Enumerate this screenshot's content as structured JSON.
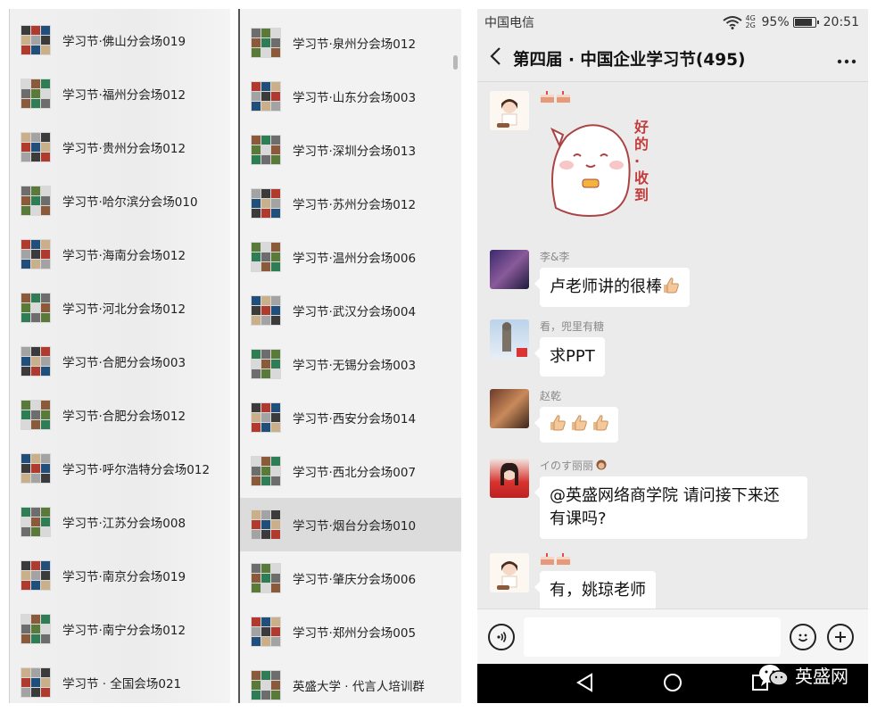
{
  "left_list": {
    "items": [
      {
        "label": "学习节·佛山分会场019"
      },
      {
        "label": "学习节·福州分会场012"
      },
      {
        "label": "学习节·贵州分会场012"
      },
      {
        "label": "学习节·哈尔滨分会场010"
      },
      {
        "label": "学习节·海南分会场012"
      },
      {
        "label": "学习节·河北分会场012"
      },
      {
        "label": "学习节·合肥分会场003"
      },
      {
        "label": "学习节·合肥分会场012"
      },
      {
        "label": "学习节·呼尔浩特分会场012"
      },
      {
        "label": "学习节·江苏分会场008"
      },
      {
        "label": "学习节·南京分会场019"
      },
      {
        "label": "学习节·南宁分会场012"
      },
      {
        "label": "学习节 · 全国会场021"
      }
    ]
  },
  "mid_list": {
    "items": [
      {
        "label": "学习节·泉州分会场012"
      },
      {
        "label": "学习节·山东分会场003"
      },
      {
        "label": "学习节·深圳分会场013"
      },
      {
        "label": "学习节·苏州分会场012"
      },
      {
        "label": "学习节·温州分会场006"
      },
      {
        "label": "学习节·武汉分会场004"
      },
      {
        "label": "学习节·无锡分会场003"
      },
      {
        "label": "学习节·西安分会场014"
      },
      {
        "label": "学习节·西北分会场007"
      },
      {
        "label": "学习节·烟台分会场010"
      },
      {
        "label": "学习节·肇庆分会场006"
      },
      {
        "label": "学习节·郑州分会场005"
      },
      {
        "label": "英盛大学 · 代言人培训群"
      }
    ]
  },
  "phone": {
    "status": {
      "carrier": "中国电信",
      "network": "4G 2G",
      "battery": "95%",
      "time": "20:51"
    },
    "title": "第四届 · 中国企业学习节(495)",
    "sticker_text": "好的·收到",
    "messages": [
      {
        "sender": "李&李",
        "text": "卢老师讲的很棒"
      },
      {
        "sender": "看，兜里有糖",
        "text": "求PPT"
      },
      {
        "sender": "赵乾",
        "text": ""
      },
      {
        "sender": "イのす丽丽",
        "text_line1": "@英盛网络商学院  请问接下来还",
        "text_line2": "有课吗?"
      },
      {
        "sender": "",
        "text": "有，姚琼老师"
      }
    ],
    "input_placeholder": ""
  },
  "watermark": {
    "text": "英盛网"
  },
  "icons": [
    "back-arrow-icon",
    "more-icon",
    "voice-icon",
    "emoji-icon",
    "add-icon",
    "nav-back-icon",
    "nav-home-icon",
    "nav-recent-icon",
    "wechat-icon",
    "wifi-icon",
    "signal-icon",
    "battery-icon",
    "thumbs-up-icon",
    "cake-icon"
  ],
  "colors": {
    "chat_bg": "#ebebeb",
    "bubble_bg": "#ffffff",
    "nav_bg": "#000000",
    "list_bg": "#f2f2f2",
    "active_row": "#dcdcdc"
  }
}
